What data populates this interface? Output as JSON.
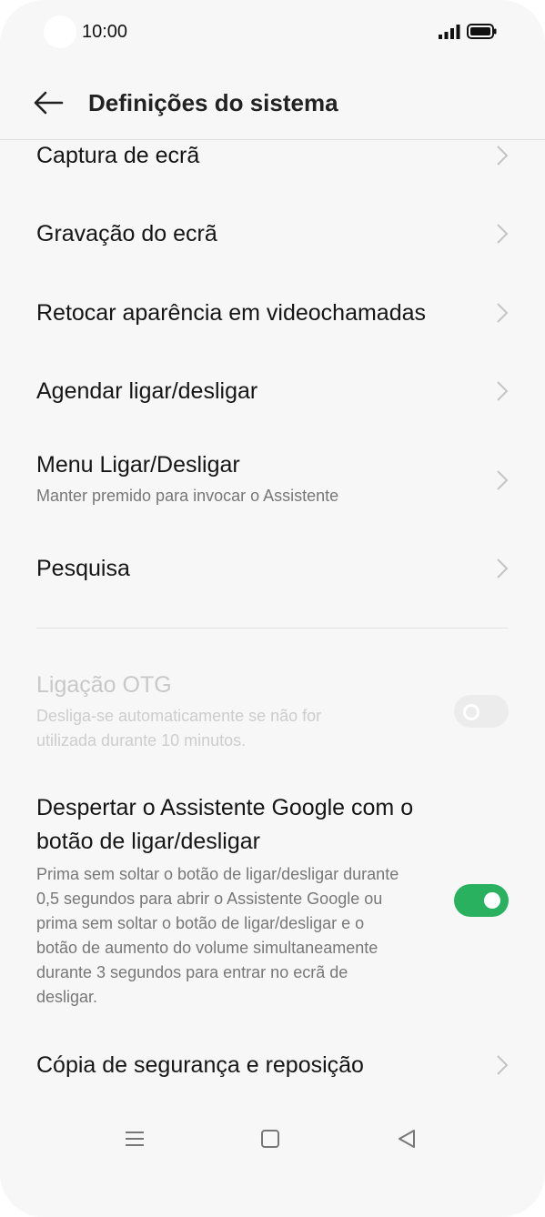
{
  "status_bar": {
    "time": "10:00"
  },
  "header": {
    "title": "Definições do sistema"
  },
  "items": [
    {
      "label": "Captura de ecrã"
    },
    {
      "label": "Gravação do ecrã"
    },
    {
      "label": "Retocar aparência em videochamadas"
    },
    {
      "label": "Agendar ligar/desligar"
    },
    {
      "label": "Menu Ligar/Desligar",
      "subtitle": "Manter premido para invocar o Assistente"
    },
    {
      "label": "Pesquisa"
    }
  ],
  "otg": {
    "label": "Ligação OTG",
    "subtitle": "Desliga-se automaticamente se não for utilizada durante 10 minutos.",
    "enabled": false,
    "state": "off"
  },
  "assistant": {
    "label": "Despertar o Assistente Google com o botão de ligar/desligar",
    "subtitle": "Prima sem soltar o botão de ligar/desligar durante 0,5 segundos para abrir o Assistente Google ou prima sem soltar o botão de ligar/desligar e o botão de aumento do volume simultaneamente durante 3 segundos para entrar no ecrã de desligar.",
    "state": "on"
  },
  "backup": {
    "label": "Cópia de segurança e reposição"
  },
  "colors": {
    "accent": "#2ab160",
    "background": "#f7f7f7"
  }
}
